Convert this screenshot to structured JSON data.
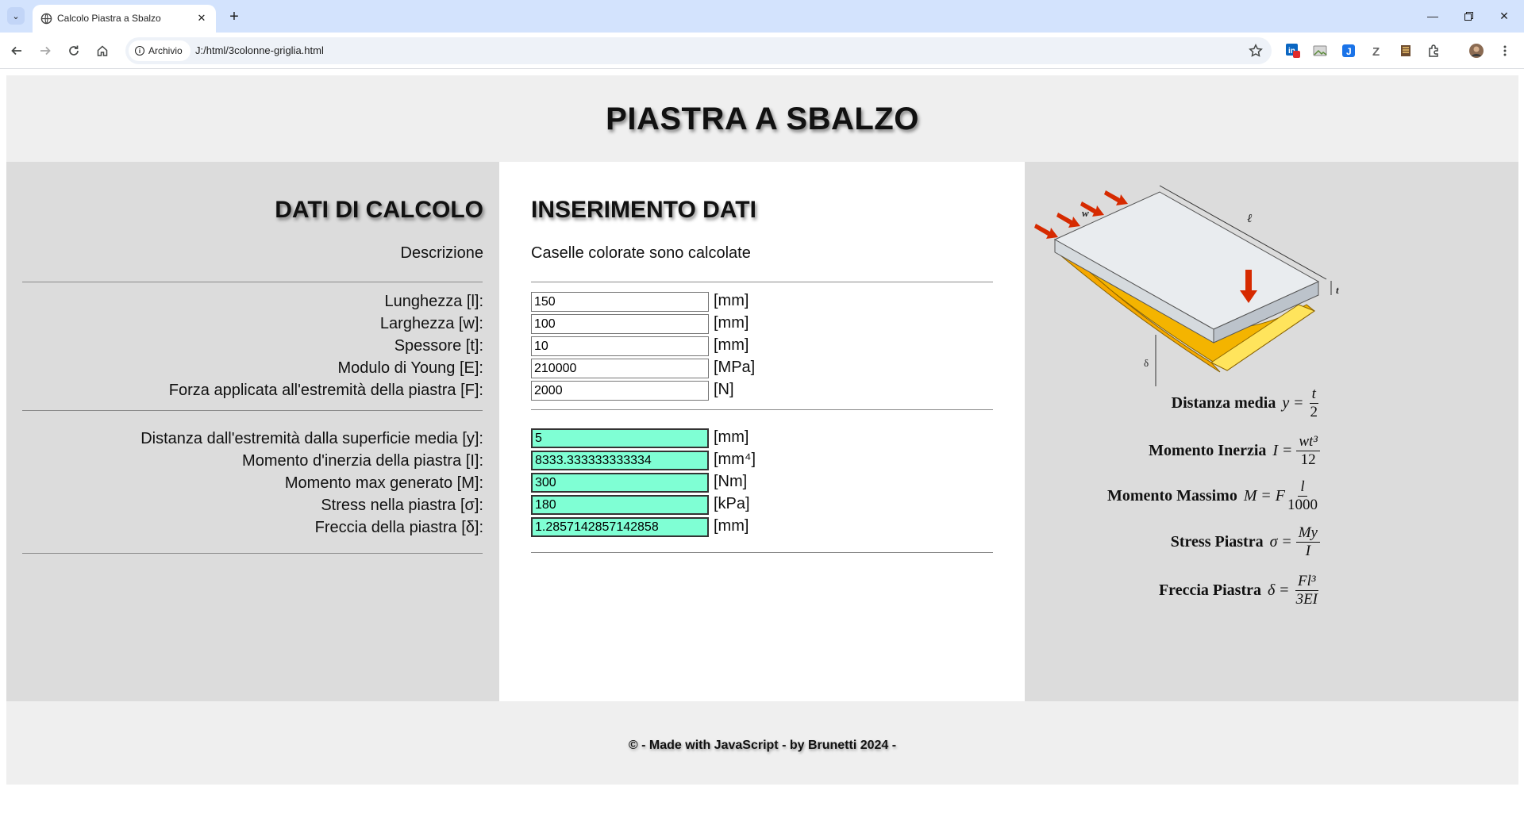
{
  "browser": {
    "tab_title": "Calcolo Piastra a Sbalzo",
    "site_chip": "Archivio",
    "url": "J:/html/3colonne-griglia.html",
    "notification_badge": "1"
  },
  "page": {
    "title": "PIASTRA A SBALZO",
    "footer": "© - Made with JavaScript - by Brunetti 2024 -"
  },
  "left": {
    "title": "DATI DI CALCOLO",
    "description_label": "Descrizione",
    "input_labels": [
      "Lunghezza [l]:",
      "Larghezza [w]:",
      "Spessore [t]:",
      "Modulo di Young [E]:",
      "Forza applicata all'estremità della piastra [F]:"
    ],
    "output_labels": [
      "Distanza dall'estremità dalla superficie media [y]:",
      "Momento d'inerzia della piastra [I]:",
      "Momento max generato [M]:",
      "Stress nella piastra [σ]:",
      "Freccia della piastra [δ]:"
    ]
  },
  "middle": {
    "title": "INSERIMENTO DATI",
    "note": "Caselle colorate sono calcolate",
    "inputs": [
      {
        "value": "150",
        "unit": "[mm]"
      },
      {
        "value": "100",
        "unit": "[mm]"
      },
      {
        "value": "10",
        "unit": "[mm]"
      },
      {
        "value": "210000",
        "unit": "[MPa]"
      },
      {
        "value": "2000",
        "unit": "[N]"
      }
    ],
    "outputs": [
      {
        "value": "5",
        "unit": "[mm]"
      },
      {
        "value": "8333.333333333334",
        "unit": "[mm⁴]"
      },
      {
        "value": "300",
        "unit": "[Nm]"
      },
      {
        "value": "180",
        "unit": "[kPa]"
      },
      {
        "value": "1.2857142857142858",
        "unit": "[mm]"
      }
    ]
  },
  "right": {
    "diagram_labels": {
      "w": "w",
      "l": "ℓ",
      "t": "t",
      "delta": "δ"
    },
    "formulas": [
      {
        "name": "Distanza media",
        "lhs": "y",
        "num": "t",
        "den": "2",
        "prefix": ""
      },
      {
        "name": "Momento Inerzia",
        "lhs": "I",
        "num": "wt³",
        "den": "12",
        "prefix": ""
      },
      {
        "name": "Momento Massimo",
        "lhs": "M",
        "num": "l",
        "den": "1000",
        "prefix": "F"
      },
      {
        "name": "Stress Piastra",
        "lhs": "σ",
        "num": "My",
        "den": "I",
        "prefix": ""
      },
      {
        "name": "Freccia Piastra",
        "lhs": "δ",
        "num": "Fl³",
        "den": "3EI",
        "prefix": ""
      }
    ]
  },
  "colors": {
    "calculated_field": "#7fffd4",
    "side_column": "#dcdcdc",
    "header_band": "#efefef",
    "tab_strip": "#d3e3fd"
  }
}
